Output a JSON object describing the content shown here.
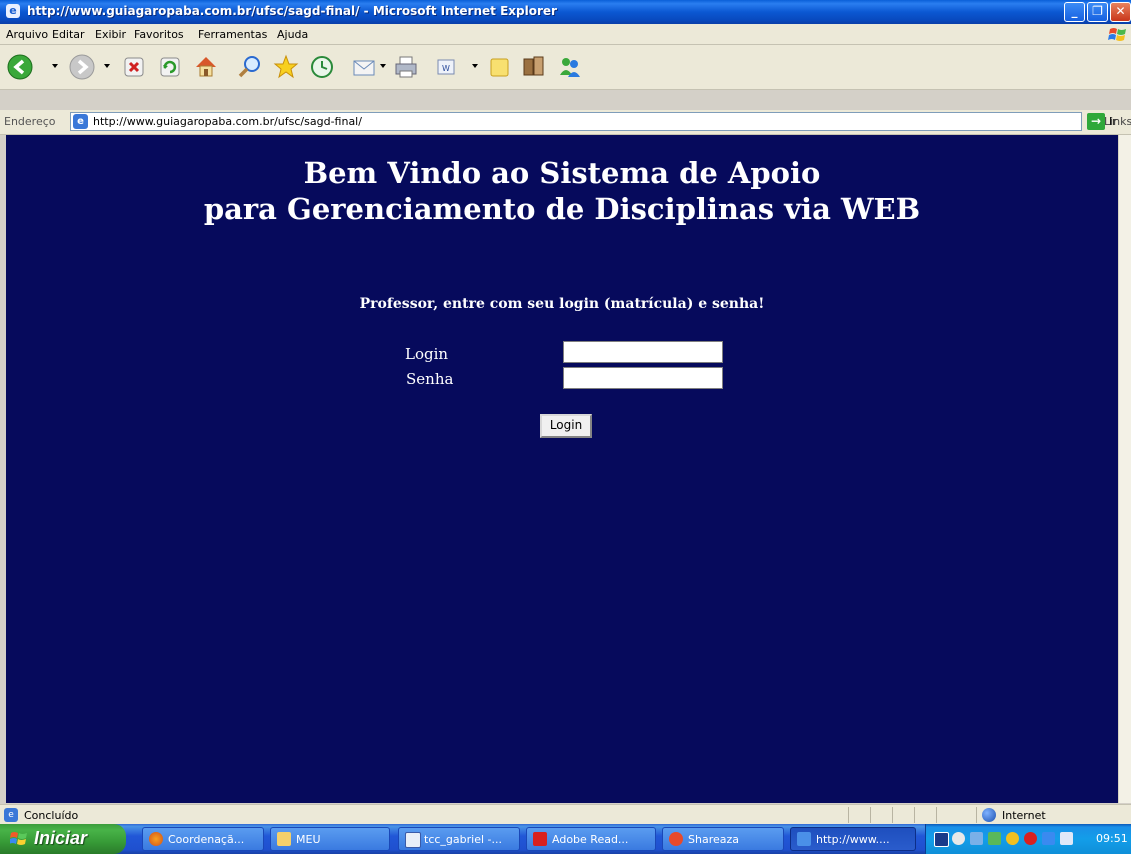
{
  "window": {
    "title": "http://www.guiagaropaba.com.br/ufsc/sagd-final/ - Microsoft Internet Explorer",
    "controls": {
      "minimize": "_",
      "maximize": "❐",
      "close": "✕"
    }
  },
  "menu": {
    "items": [
      "Arquivo",
      "Editar",
      "Exibir",
      "Favoritos",
      "Ferramentas",
      "Ajuda"
    ]
  },
  "toolbar": {
    "buttons": [
      "back-icon",
      "forward-icon",
      "stop-icon",
      "refresh-icon",
      "home-icon",
      "search-icon",
      "favorites-icon",
      "history-icon",
      "mail-icon",
      "print-icon",
      "edit-icon",
      "discuss-icon",
      "research-icon",
      "messenger-icon"
    ]
  },
  "address": {
    "label": "Endereço",
    "url": "http://www.guiagaropaba.com.br/ufsc/sagd-final/",
    "go_label": "Ir",
    "links_label": "Links"
  },
  "page": {
    "heading_line1": "Bem Vindo ao Sistema de Apoio",
    "heading_line2": "para Gerenciamento de Disciplinas via WEB",
    "instructions": "Professor, entre com seu login (matrícula) e senha!",
    "login_label": "Login",
    "login_value": "",
    "password_label": "Senha",
    "password_value": "",
    "submit_label": "Login"
  },
  "status": {
    "text": "Concluído",
    "zone": "Internet"
  },
  "taskbar": {
    "start_label": "Iniciar",
    "tasks": [
      {
        "label": "Coordenaçã..."
      },
      {
        "label": "MEU"
      },
      {
        "label": "tcc_gabriel -..."
      },
      {
        "label": "Adobe Read..."
      },
      {
        "label": "Shareaza"
      },
      {
        "label": "http://www...."
      }
    ],
    "clock": "09:51"
  },
  "colors": {
    "page_background": "#060a5c",
    "page_text": "#ffffff"
  }
}
